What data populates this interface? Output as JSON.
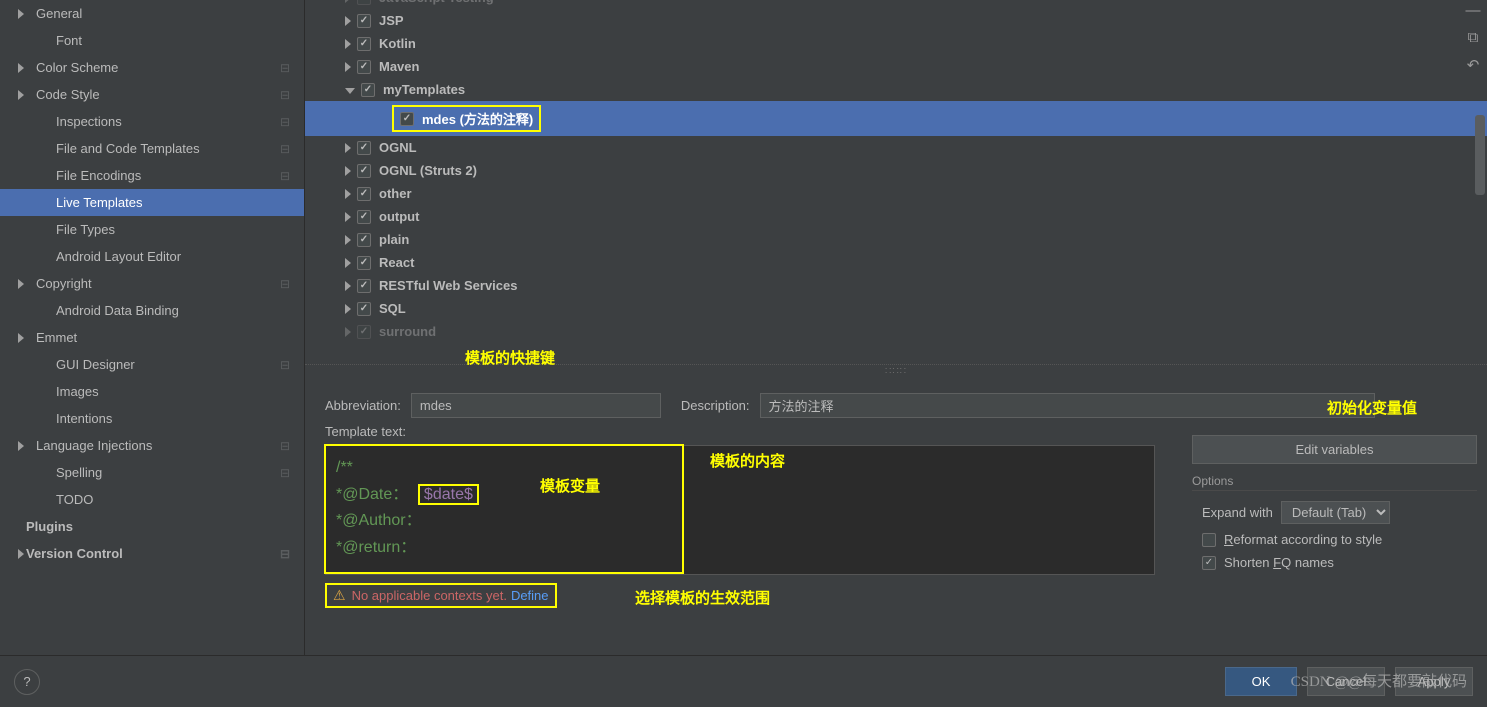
{
  "sidebar": {
    "items": [
      {
        "label": "General",
        "arrow": true,
        "bold": false,
        "level": 0
      },
      {
        "label": "Font",
        "arrow": false,
        "bold": false,
        "level": 1
      },
      {
        "label": "Color Scheme",
        "arrow": true,
        "bold": false,
        "level": 0,
        "gear": true
      },
      {
        "label": "Code Style",
        "arrow": true,
        "bold": false,
        "level": 0,
        "gear": true
      },
      {
        "label": "Inspections",
        "arrow": false,
        "bold": false,
        "level": 1,
        "gear": true
      },
      {
        "label": "File and Code Templates",
        "arrow": false,
        "bold": false,
        "level": 1,
        "gear": true
      },
      {
        "label": "File Encodings",
        "arrow": false,
        "bold": false,
        "level": 1,
        "gear": true
      },
      {
        "label": "Live Templates",
        "arrow": false,
        "bold": false,
        "level": 1,
        "selected": true
      },
      {
        "label": "File Types",
        "arrow": false,
        "bold": false,
        "level": 1
      },
      {
        "label": "Android Layout Editor",
        "arrow": false,
        "bold": false,
        "level": 1
      },
      {
        "label": "Copyright",
        "arrow": true,
        "bold": false,
        "level": 0,
        "gear": true
      },
      {
        "label": "Android Data Binding",
        "arrow": false,
        "bold": false,
        "level": 1
      },
      {
        "label": "Emmet",
        "arrow": true,
        "bold": false,
        "level": 0
      },
      {
        "label": "GUI Designer",
        "arrow": false,
        "bold": false,
        "level": 1,
        "gear": true
      },
      {
        "label": "Images",
        "arrow": false,
        "bold": false,
        "level": 1
      },
      {
        "label": "Intentions",
        "arrow": false,
        "bold": false,
        "level": 1
      },
      {
        "label": "Language Injections",
        "arrow": true,
        "bold": false,
        "level": 0,
        "gear": true
      },
      {
        "label": "Spelling",
        "arrow": false,
        "bold": false,
        "level": 1,
        "gear": true
      },
      {
        "label": "TODO",
        "arrow": false,
        "bold": false,
        "level": 1
      },
      {
        "label": "Plugins",
        "arrow": false,
        "bold": true,
        "level": -1
      },
      {
        "label": "Version Control",
        "arrow": true,
        "bold": true,
        "level": -1,
        "gear": true
      }
    ]
  },
  "tree": [
    {
      "label": "JavaScript Testing",
      "checked": true,
      "arrow": "right",
      "level": 0,
      "faded": true
    },
    {
      "label": "JSP",
      "checked": true,
      "arrow": "right",
      "level": 0
    },
    {
      "label": "Kotlin",
      "checked": true,
      "arrow": "right",
      "level": 0
    },
    {
      "label": "Maven",
      "checked": true,
      "arrow": "right",
      "level": 0
    },
    {
      "label": "myTemplates",
      "checked": true,
      "arrow": "down",
      "level": 0
    },
    {
      "label": "mdes (方法的注释)",
      "checked": true,
      "arrow": "",
      "level": 1,
      "selected": true,
      "yellowbox": true
    },
    {
      "label": "OGNL",
      "checked": true,
      "arrow": "right",
      "level": 0
    },
    {
      "label": "OGNL (Struts 2)",
      "checked": true,
      "arrow": "right",
      "level": 0
    },
    {
      "label": "other",
      "checked": true,
      "arrow": "right",
      "level": 0
    },
    {
      "label": "output",
      "checked": true,
      "arrow": "right",
      "level": 0
    },
    {
      "label": "plain",
      "checked": true,
      "arrow": "right",
      "level": 0
    },
    {
      "label": "React",
      "checked": true,
      "arrow": "right",
      "level": 0
    },
    {
      "label": "RESTful Web Services",
      "checked": true,
      "arrow": "right",
      "level": 0
    },
    {
      "label": "SQL",
      "checked": true,
      "arrow": "right",
      "level": 0
    },
    {
      "label": "surround",
      "checked": true,
      "arrow": "right",
      "level": 0,
      "faded": true
    }
  ],
  "editor": {
    "abbr_label": "Abbreviation:",
    "abbr_value": "mdes",
    "desc_label": "Description:",
    "desc_value": "方法的注释",
    "template_text_label": "Template text:",
    "edit_vars_btn": "Edit variables",
    "code_l1": "/**",
    "code_l2a": "*@Date：",
    "code_l2b": "$date$",
    "code_l3": "*@Author：",
    "code_l4": "*@return：",
    "warn_text": "No applicable contexts yet.",
    "define": "Define",
    "options_title": "Options",
    "expand_label": "Expand with",
    "expand_value": "Default (Tab)",
    "reformat": "Reformat according to style",
    "shorten": "Shorten FQ names"
  },
  "annotations": {
    "shortcut": "模板的快捷键",
    "initvar": "初始化变量值",
    "content": "模板的内容",
    "varname": "模板变量",
    "context": "选择模板的生效范围"
  },
  "bottom": {
    "ok": "OK",
    "cancel": "Cancel",
    "apply": "Apply"
  },
  "watermark": "CSDN @@每天都要敲代码",
  "underline": {
    "R": "R",
    "E": "E",
    "F": "F"
  }
}
